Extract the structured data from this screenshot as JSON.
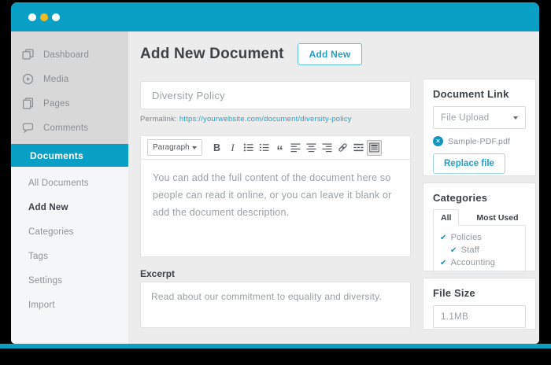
{
  "theme": {
    "accent_teal": "#0a9fc5",
    "link_teal": "#1da2c6",
    "check_teal": "#1295bb",
    "yellow_dot": "#f5b81d",
    "sidebar_gray": "#d8d8d8",
    "main_bg": "#ececec",
    "dark_text": "#3d4247",
    "muted_text": "#9aa0a5"
  },
  "sidebar": {
    "top_items": [
      {
        "label": "Dashboard",
        "icon": "dashboard-icon"
      },
      {
        "label": "Media",
        "icon": "media-icon"
      },
      {
        "label": "Pages",
        "icon": "pages-icon"
      },
      {
        "label": "Comments",
        "icon": "comments-icon"
      }
    ],
    "active_item": {
      "label": "Documents"
    },
    "sub_items": [
      {
        "label": "All Documents"
      },
      {
        "label": "Add New",
        "current": true
      },
      {
        "label": "Categories"
      },
      {
        "label": "Tags"
      },
      {
        "label": "Settings"
      },
      {
        "label": "Import"
      }
    ]
  },
  "main": {
    "page_title": "Add New Document",
    "add_new_button": "Add New",
    "title_input": {
      "value": "Diversity Policy"
    },
    "permalink": {
      "label": "Permalink:",
      "url": "https://yourwebsite.com/document/diversity-policy"
    },
    "editor": {
      "toolbar": {
        "blocks_dropdown": "Paragraph",
        "icons": [
          {
            "name": "bold-icon",
            "glyph": "B"
          },
          {
            "name": "italic-icon",
            "glyph": "I"
          },
          {
            "name": "bulleted-list-icon"
          },
          {
            "name": "numbered-list-icon"
          },
          {
            "name": "blockquote-icon",
            "glyph": "“"
          },
          {
            "name": "align-left-icon"
          },
          {
            "name": "align-center-icon"
          },
          {
            "name": "align-right-icon"
          },
          {
            "name": "link-icon"
          },
          {
            "name": "read-more-icon"
          },
          {
            "name": "toolbar-toggle-icon",
            "active": true
          }
        ]
      },
      "content": "You can add the full content of the document here so people can read it online, or you can leave it blank or add the document description."
    },
    "excerpt": {
      "label": "Excerpt",
      "value": "Read about our commitment to equality and diversity."
    }
  },
  "panels": {
    "document_link": {
      "title": "Document Link",
      "file_upload_dropdown": "File Upload",
      "attached_file": "Sample-PDF.pdf",
      "replace_button": "Replace file"
    },
    "categories": {
      "title": "Categories",
      "tabs": [
        {
          "label": "All",
          "active": true
        },
        {
          "label": "Most Used",
          "active": false
        }
      ],
      "items": [
        {
          "label": "Policies",
          "checked": true,
          "indent": false
        },
        {
          "label": "Staff",
          "checked": true,
          "indent": true
        },
        {
          "label": "Accounting",
          "checked": true,
          "indent": false
        }
      ]
    },
    "file_size": {
      "title": "File Size",
      "value": "1.1MB"
    }
  }
}
